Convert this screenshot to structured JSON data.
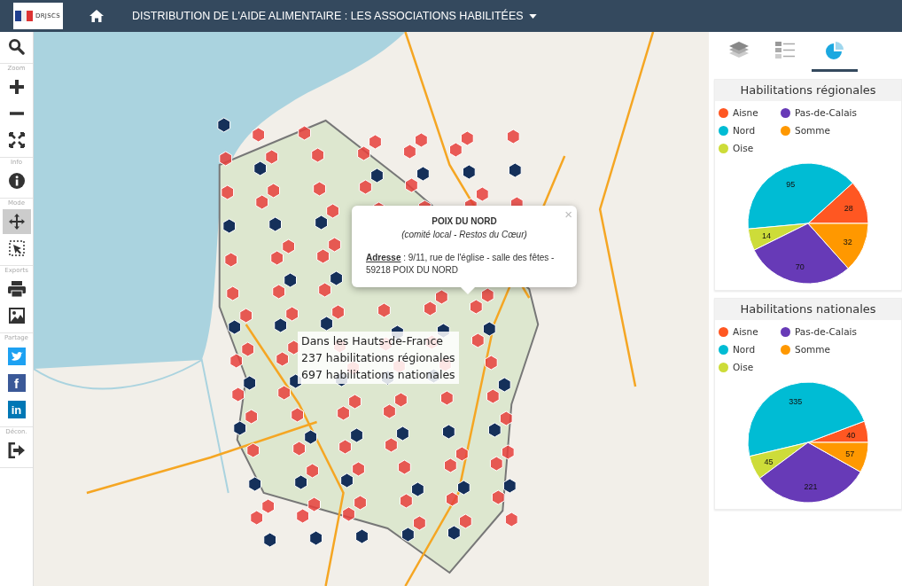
{
  "header": {
    "logo_text": "DRJSCS",
    "title": "DISTRIBUTION DE L'AIDE ALIMENTAIRE : LES ASSOCIATIONS HABILITÉES"
  },
  "toolbar": [
    {
      "items": [
        {
          "kind": "search",
          "selected": false
        }
      ]
    },
    {
      "label": "Zoom",
      "items": [
        {
          "kind": "zoom-in",
          "selected": false
        },
        {
          "kind": "zoom-out",
          "selected": false
        },
        {
          "kind": "fullscreen",
          "selected": false
        }
      ]
    },
    {
      "label": "Info",
      "items": [
        {
          "kind": "info",
          "selected": false
        }
      ]
    },
    {
      "label": "Mode",
      "items": [
        {
          "kind": "pan",
          "selected": true
        },
        {
          "kind": "select",
          "selected": false
        }
      ]
    },
    {
      "label": "Exports",
      "items": [
        {
          "kind": "print",
          "selected": false
        },
        {
          "kind": "image",
          "selected": false
        }
      ]
    },
    {
      "label": "Partage",
      "items": [
        {
          "kind": "twitter",
          "selected": false
        },
        {
          "kind": "facebook",
          "glyph": "f",
          "selected": false
        },
        {
          "kind": "linkedin",
          "glyph": "in",
          "selected": false
        }
      ]
    },
    {
      "label": "Décon.",
      "items": [
        {
          "kind": "logout",
          "selected": false
        }
      ]
    }
  ],
  "popup": {
    "title": "POIX DU NORD",
    "subtitle": "(comité local - Restos du Cœur)",
    "address_label": "Adresse",
    "address": " : 9/11, rue de l'église - salle des fêtes - 59218 POIX DU NORD",
    "close": "×"
  },
  "summary": [
    "Dans les Hauts-de-France",
    "237 habilitations régionales",
    "697 habilitations nationales"
  ],
  "panel_tabs": [
    {
      "kind": "layers",
      "selected": false
    },
    {
      "kind": "legend",
      "selected": false
    },
    {
      "kind": "chart",
      "selected": true
    }
  ],
  "charts": [
    {
      "title": "Habilitations régionales",
      "chart_data": {
        "type": "pie",
        "categories": [
          "Aisne",
          "Nord",
          "Oise",
          "Pas-de-Calais",
          "Somme"
        ],
        "series": [
          {
            "colors": [
              "#ff5722",
              "#00bcd4",
              "#cddc39",
              "#673ab7",
              "#ff9800"
            ],
            "values": [
              28,
              95,
              14,
              70,
              32
            ]
          }
        ],
        "data_labels": true
      }
    },
    {
      "title": "Habilitations nationales",
      "chart_data": {
        "type": "pie",
        "categories": [
          "Aisne",
          "Nord",
          "Oise",
          "Pas-de-Calais",
          "Somme"
        ],
        "series": [
          {
            "colors": [
              "#ff5722",
              "#00bcd4",
              "#cddc39",
              "#673ab7",
              "#ff9800"
            ],
            "values": [
              40,
              335,
              45,
              221,
              57
            ]
          }
        ],
        "data_labels": true
      }
    }
  ]
}
